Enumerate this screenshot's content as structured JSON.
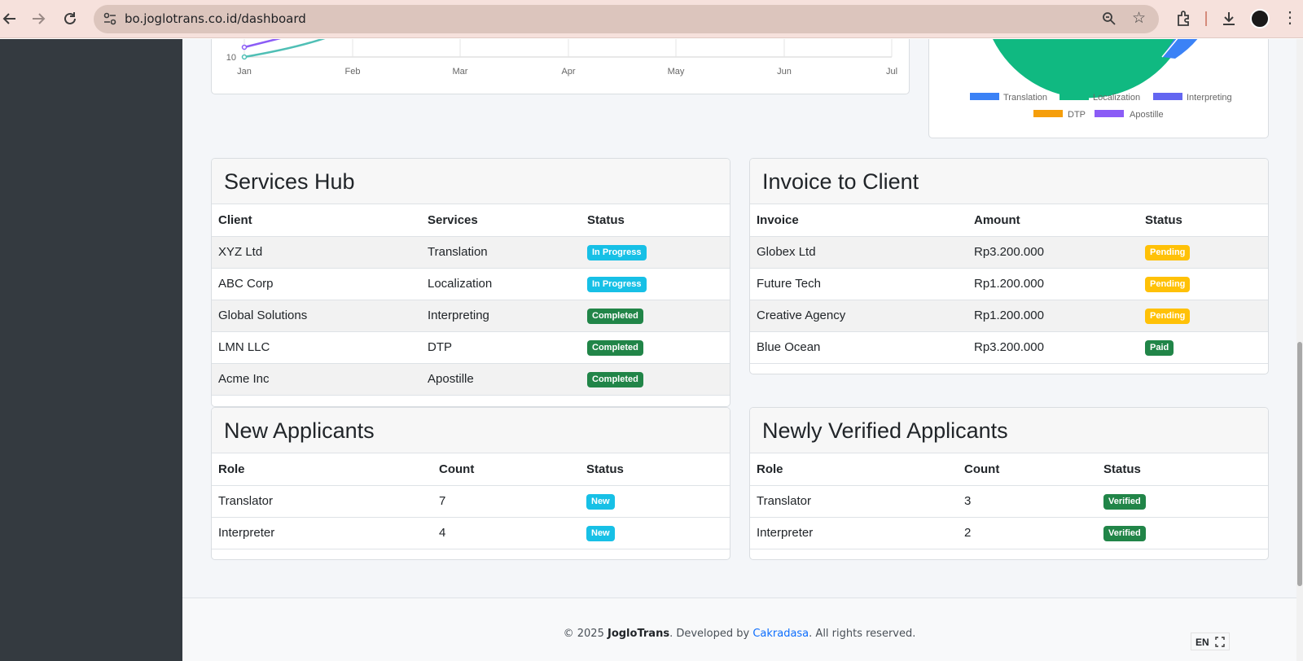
{
  "browser": {
    "url": "bo.joglotrans.co.id/dashboard"
  },
  "line_chart": {
    "y_tick": "10",
    "x_ticks": [
      "Jan",
      "Feb",
      "Mar",
      "Apr",
      "May",
      "Jun",
      "Jul"
    ],
    "colors": [
      "#8b5cf6",
      "#4fbfb5"
    ]
  },
  "pie_chart": {
    "legend": [
      {
        "label": "Translation",
        "color": "#3b82f6"
      },
      {
        "label": "Localization",
        "color": "#10b981"
      },
      {
        "label": "Interpreting",
        "color": "#6366f1"
      },
      {
        "label": "DTP",
        "color": "#f59e0b"
      },
      {
        "label": "Apostille",
        "color": "#8b5cf6"
      }
    ]
  },
  "services_hub": {
    "title": "Services Hub",
    "headers": [
      "Client",
      "Services",
      "Status"
    ],
    "rows": [
      {
        "client": "XYZ Ltd",
        "service": "Translation",
        "status": "In Progress"
      },
      {
        "client": "ABC Corp",
        "service": "Localization",
        "status": "In Progress"
      },
      {
        "client": "Global Solutions",
        "service": "Interpreting",
        "status": "Completed"
      },
      {
        "client": "LMN LLC",
        "service": "DTP",
        "status": "Completed"
      },
      {
        "client": "Acme Inc",
        "service": "Apostille",
        "status": "Completed"
      }
    ]
  },
  "invoice": {
    "title": "Invoice to Client",
    "headers": [
      "Invoice",
      "Amount",
      "Status"
    ],
    "rows": [
      {
        "invoice": "Globex Ltd",
        "amount": "Rp3.200.000",
        "status": "Pending"
      },
      {
        "invoice": "Future Tech",
        "amount": "Rp1.200.000",
        "status": "Pending"
      },
      {
        "invoice": "Creative Agency",
        "amount": "Rp1.200.000",
        "status": "Pending"
      },
      {
        "invoice": "Blue Ocean",
        "amount": "Rp3.200.000",
        "status": "Paid"
      }
    ]
  },
  "new_applicants": {
    "title": "New Applicants",
    "headers": [
      "Role",
      "Count",
      "Status"
    ],
    "rows": [
      {
        "role": "Translator",
        "count": "7",
        "status": "New"
      },
      {
        "role": "Interpreter",
        "count": "4",
        "status": "New"
      }
    ]
  },
  "verified_applicants": {
    "title": "Newly Verified Applicants",
    "headers": [
      "Role",
      "Count",
      "Status"
    ],
    "rows": [
      {
        "role": "Translator",
        "count": "3",
        "status": "Verified"
      },
      {
        "role": "Interpreter",
        "count": "2",
        "status": "Verified"
      }
    ]
  },
  "footer": {
    "prefix": "© 2025 ",
    "brand": "JogloTrans",
    "middle": ". Developed by ",
    "link": "Cakradasa",
    "suffix": ". All rights reserved."
  },
  "lang": "EN"
}
